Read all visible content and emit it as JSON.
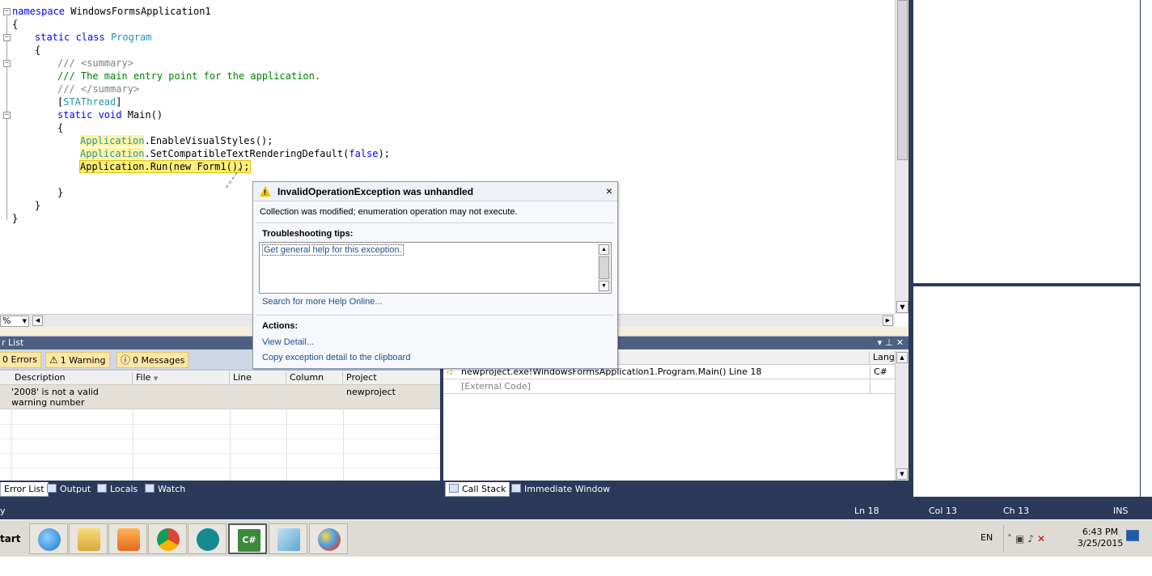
{
  "editor": {
    "code": {
      "l1_kw": "namespace",
      "l1_name": " WindowsFormsApplication1",
      "l2": "{",
      "l3_kw": "static class",
      "l3_type": "Program",
      "l4": "{",
      "l5_prefix": "///",
      "l5_tag": " <summary>",
      "l6": "/// The main entry point for the application.",
      "l7_prefix": "///",
      "l7_tag": " </summary>",
      "l8_open": "[",
      "l8_attr": "STAThread",
      "l8_close": "]",
      "l9_kw": "static void",
      "l9_rest": " Main()",
      "l10": "{",
      "l11_type": "Application",
      "l11_rest": ".EnableVisualStyles();",
      "l12_type": "Application",
      "l12_mid": ".SetCompatibleTextRenderingDefault(",
      "l12_kw": "false",
      "l12_end": ");",
      "l13": "Application.Run(new Form1());",
      "l14": "}",
      "l15": "}",
      "l16": "}"
    },
    "zoom_value": "%"
  },
  "exception": {
    "title": "InvalidOperationException was unhandled",
    "message": "Collection was modified; enumeration operation may not execute.",
    "tips_label": "Troubleshooting tips:",
    "tip_link": "Get general help for this exception.",
    "help_online": "Search for more Help Online...",
    "actions_label": "Actions:",
    "view_detail": "View Detail...",
    "copy_detail": "Copy exception detail to the clipboard",
    "close_glyph": "×"
  },
  "error_list": {
    "title": "r List",
    "filters": {
      "errors": "0 Errors",
      "warnings": "1 Warning",
      "messages": "0 Messages"
    },
    "columns": [
      "Description",
      "File",
      "Line",
      "Column",
      "Project"
    ],
    "rows": [
      {
        "description": "'2008' is not a valid warning number",
        "file": "",
        "line": "",
        "column": "",
        "project": "newproject"
      }
    ]
  },
  "call_stack": {
    "columns": [
      "",
      "Langu"
    ],
    "rows": [
      {
        "name": "newproject.exe!WindowsFormsApplication1.Program.Main() Line 18",
        "lang": "C#"
      },
      {
        "name": "[External Code]",
        "lang": ""
      }
    ]
  },
  "tabs": {
    "left": [
      "Error List",
      "Output",
      "Locals",
      "Watch"
    ],
    "right": [
      "Call Stack",
      "Immediate Window"
    ]
  },
  "status_bar": {
    "left": "y",
    "ln": "Ln 18",
    "col": "Col 13",
    "ch": "Ch 13",
    "ins": "INS"
  },
  "taskbar": {
    "start": "tart",
    "lang": "EN",
    "time": "6:43 PM",
    "date": "3/25/2015",
    "apps": [
      "internet-explorer",
      "file-explorer",
      "media-player",
      "chrome",
      "arduino",
      "visual-csharp",
      "notebook",
      "paint"
    ]
  },
  "colors": {
    "keyword": "#0000ff",
    "type": "#2b91af",
    "comment": "#008000",
    "tool_window_bg": "#2b3a5a",
    "highlight": "#fff07a"
  }
}
